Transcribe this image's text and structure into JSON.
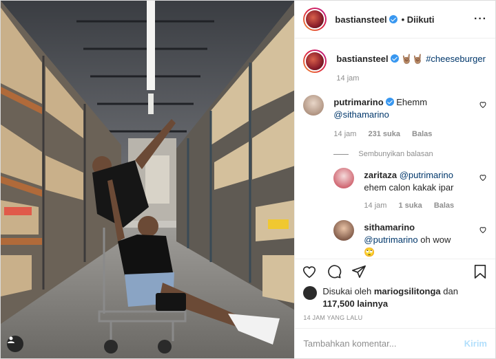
{
  "header": {
    "username": "bastiansteel",
    "follow_status": "• Diikuti",
    "more_icon": "more-horizontal-icon"
  },
  "caption": {
    "username": "bastiansteel",
    "emoji": "🤘🏽🤘🏽",
    "hashtag": "#cheeseburger",
    "time": "14 jam"
  },
  "comments": [
    {
      "username": "putrimarino",
      "text": "Ehemm",
      "mention": "@sithamarino",
      "time": "14 jam",
      "likes": "231 suka",
      "reply": "Balas"
    }
  ],
  "hide_replies": "Sembunyikan balasan",
  "replies": [
    {
      "username": "zaritaza",
      "mention": "@putrimarino",
      "text": "ehem calon kakak ipar",
      "time": "14 jam",
      "likes": "1 suka",
      "reply": "Balas"
    },
    {
      "username": "sithamarino",
      "mention": "@putrimarino",
      "text": "oh wow",
      "emoji": "🙄"
    }
  ],
  "likes": {
    "prefix": "Disukai oleh",
    "user": "mariogsilitonga",
    "and": "dan",
    "others": "117,500 lainnya"
  },
  "timestamp": "14 JAM YANG LALU",
  "add_comment": {
    "placeholder": "Tambahkan komentar...",
    "post_label": "Kirim"
  },
  "colors": {
    "verified": "#3897f0",
    "link": "#00376b",
    "muted": "#8e8e8e",
    "post_disabled": "#b2dffc"
  }
}
